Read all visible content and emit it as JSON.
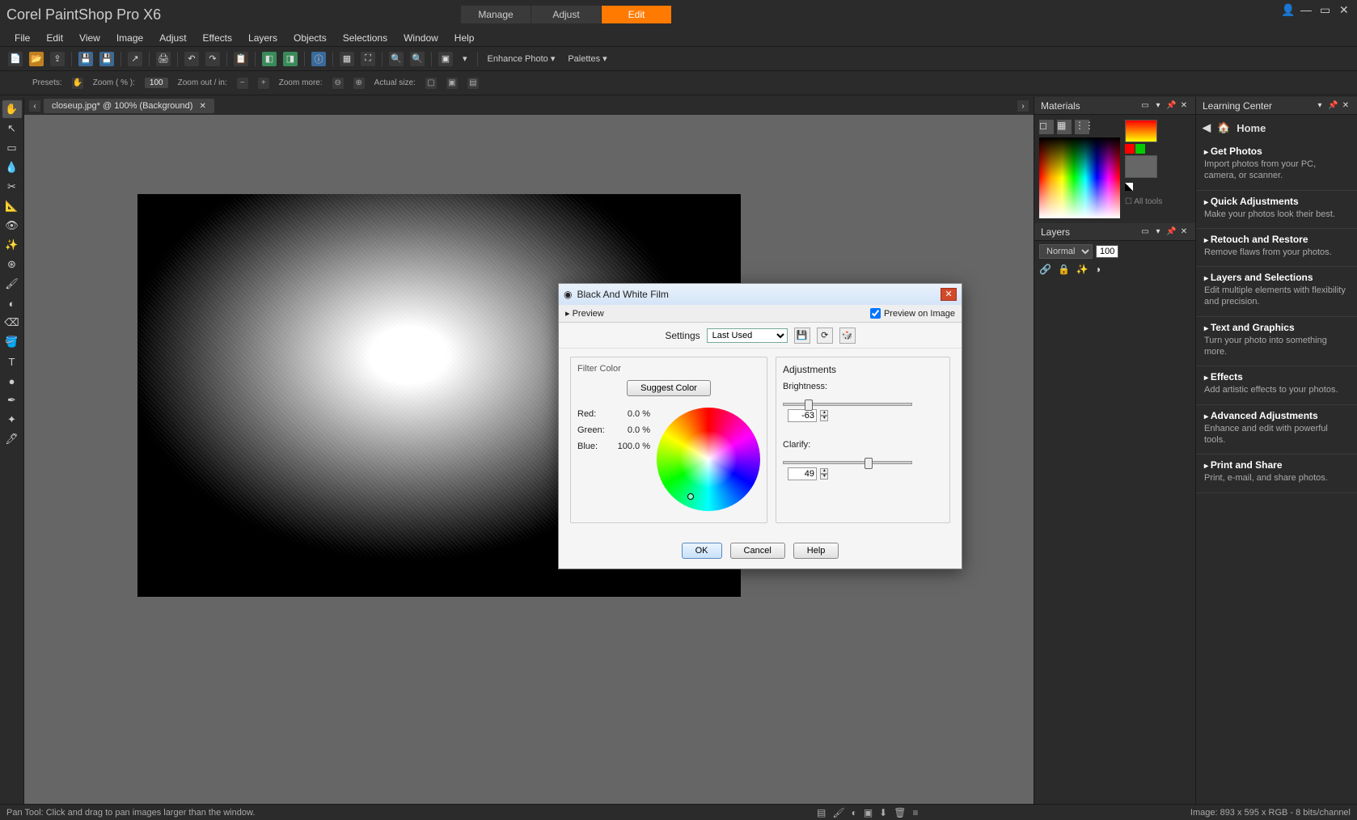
{
  "app_title": "Corel PaintShop Pro X6",
  "workspace_tabs": [
    "Manage",
    "Adjust",
    "Edit"
  ],
  "active_workspace_tab": "Edit",
  "menubar": [
    "File",
    "Edit",
    "View",
    "Image",
    "Adjust",
    "Effects",
    "Layers",
    "Objects",
    "Selections",
    "Window",
    "Help"
  ],
  "toolbar_text": {
    "enhance": "Enhance Photo",
    "palettes": "Palettes"
  },
  "options_bar": {
    "presets_label": "Presets:",
    "zoom_pct_label": "Zoom ( % ):",
    "zoom_value": "100",
    "zoom_inout_label": "Zoom out / in:",
    "zoom_more_label": "Zoom more:",
    "actual_size_label": "Actual size:"
  },
  "document_tab": "closeup.jpg* @ 100% (Background)",
  "panels": {
    "materials_title": "Materials",
    "all_tools": "All tools",
    "layers_title": "Layers",
    "blend_mode": "Normal",
    "opacity": "100"
  },
  "learning": {
    "title": "Learning Center",
    "home": "Home",
    "sections": [
      {
        "title": "Get Photos",
        "desc": "Import photos from your PC, camera, or scanner."
      },
      {
        "title": "Quick Adjustments",
        "desc": "Make your photos look their best."
      },
      {
        "title": "Retouch and Restore",
        "desc": "Remove flaws from your photos."
      },
      {
        "title": "Layers and Selections",
        "desc": "Edit multiple elements with flexibility and precision."
      },
      {
        "title": "Text and Graphics",
        "desc": "Turn your photo into something more."
      },
      {
        "title": "Effects",
        "desc": "Add artistic effects to your photos."
      },
      {
        "title": "Advanced Adjustments",
        "desc": "Enhance and edit with powerful tools."
      },
      {
        "title": "Print and Share",
        "desc": "Print, e-mail, and share photos."
      }
    ]
  },
  "dialog": {
    "title": "Black And White Film",
    "preview": "Preview",
    "preview_on_image": "Preview on Image",
    "settings_label": "Settings",
    "settings_value": "Last Used",
    "filter_color_label": "Filter Color",
    "suggest_color": "Suggest Color",
    "red_label": "Red:",
    "red_val": "0.0 %",
    "green_label": "Green:",
    "green_val": "0.0 %",
    "blue_label": "Blue:",
    "blue_val": "100.0 %",
    "adjustments_label": "Adjustments",
    "brightness_label": "Brightness:",
    "brightness_val": "-63",
    "clarify_label": "Clarify:",
    "clarify_val": "49",
    "ok": "OK",
    "cancel": "Cancel",
    "help": "Help"
  },
  "statusbar": {
    "hint": "Pan Tool: Click and drag to pan images larger than the window.",
    "image_info": "Image:  893 x 595 x RGB - 8 bits/channel"
  }
}
